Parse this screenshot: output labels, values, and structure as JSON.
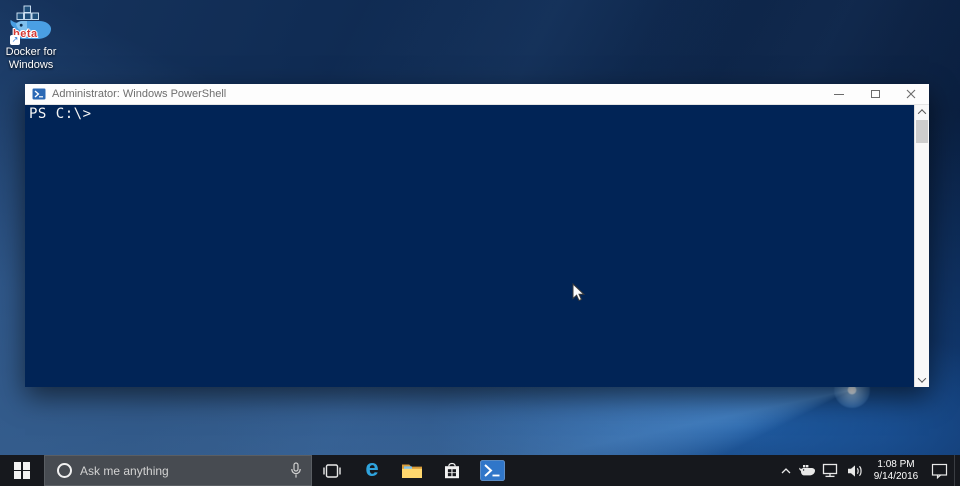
{
  "desktop": {
    "docker_icon": {
      "label": "Docker for Windows",
      "beta_tag": "beta",
      "shortcut_glyph": "↗"
    }
  },
  "powershell_window": {
    "title": "Administrator: Windows PowerShell",
    "console_prompt": "PS C:\\>"
  },
  "taskbar": {
    "search": {
      "placeholder": "Ask me anything"
    },
    "app_icons": [
      {
        "name": "task-view-icon"
      },
      {
        "name": "edge-icon",
        "glyph": "e"
      },
      {
        "name": "file-explorer-icon"
      },
      {
        "name": "store-icon"
      },
      {
        "name": "powershell-icon"
      }
    ],
    "tray": {
      "time": "1:08 PM",
      "date": "9/14/2016",
      "icons": [
        "chevron-up-icon",
        "docker-whale-icon",
        "network-icon",
        "speaker-icon",
        "action-center-icon"
      ]
    }
  },
  "colors": {
    "console_background": "#012456",
    "titlebar_background": "#fdfdfd",
    "taskbar_background": "#16181d",
    "search_box_background": "#474b51",
    "powershell_icon_blue": "#3076c9",
    "edge_blue": "#2fa3dd",
    "folder_yellow": "#ffd76e",
    "beta_red": "#d43a35",
    "wallpaper_base_blue": "#0c2448"
  }
}
